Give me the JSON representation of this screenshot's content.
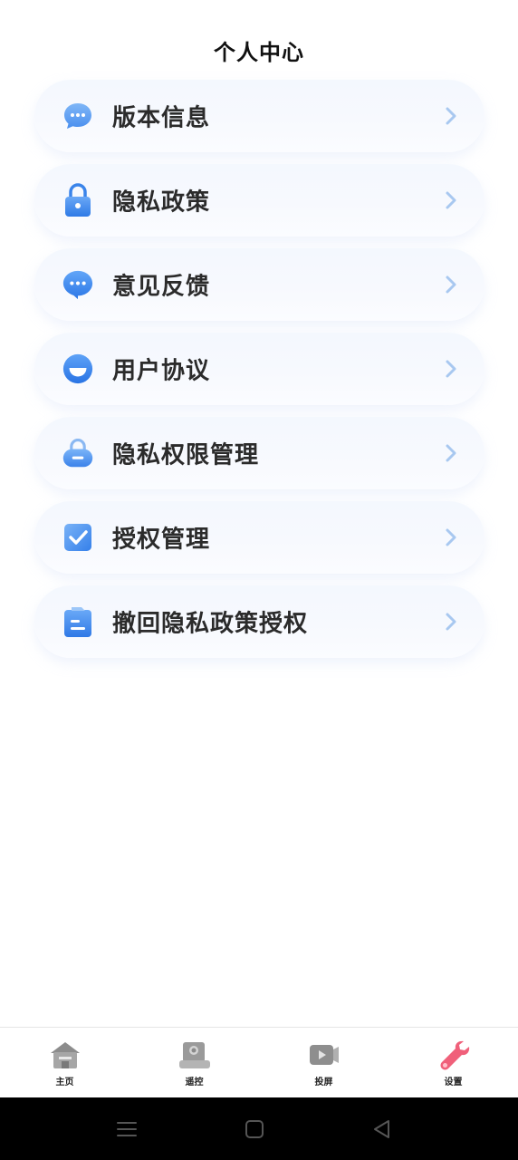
{
  "header": {
    "title": "个人中心"
  },
  "menu": {
    "items": [
      {
        "label": "版本信息",
        "icon": "chat-bubble-icon"
      },
      {
        "label": "隐私政策",
        "icon": "lock-icon"
      },
      {
        "label": "意见反馈",
        "icon": "message-icon"
      },
      {
        "label": "用户协议",
        "icon": "agreement-icon"
      },
      {
        "label": "隐私权限管理",
        "icon": "permission-lock-icon"
      },
      {
        "label": "授权管理",
        "icon": "checkbox-icon"
      },
      {
        "label": "撤回隐私政策授权",
        "icon": "revoke-document-icon"
      }
    ]
  },
  "tabbar": {
    "tabs": [
      {
        "label": "主页",
        "icon": "home-icon",
        "active": false
      },
      {
        "label": "遥控",
        "icon": "remote-icon",
        "active": false
      },
      {
        "label": "投屏",
        "icon": "video-cast-icon",
        "active": false
      },
      {
        "label": "设置",
        "icon": "wrench-icon",
        "active": true
      }
    ]
  },
  "colors": {
    "accent_blue": "#4a90f0",
    "chevron": "#a8c8f0",
    "active_tab": "#f0607a",
    "inactive_tab": "#8a8a8a"
  }
}
